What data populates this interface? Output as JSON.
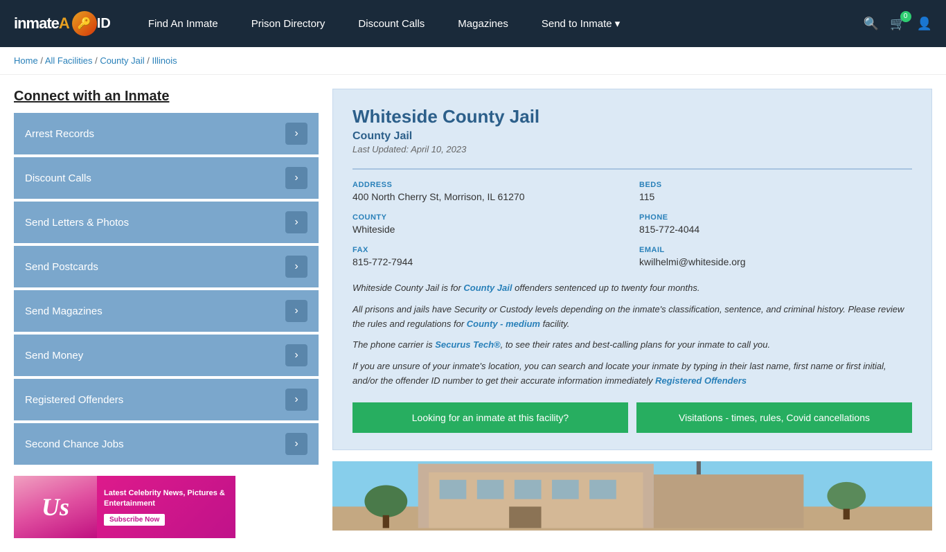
{
  "header": {
    "logo": "inmateAID",
    "nav": [
      {
        "label": "Find An Inmate",
        "id": "find-inmate"
      },
      {
        "label": "Prison Directory",
        "id": "prison-directory"
      },
      {
        "label": "Discount Calls",
        "id": "discount-calls"
      },
      {
        "label": "Magazines",
        "id": "magazines"
      },
      {
        "label": "Send to Inmate ▾",
        "id": "send-to-inmate"
      }
    ],
    "cart_count": "0"
  },
  "breadcrumb": {
    "items": [
      "Home",
      "All Facilities",
      "County Jail",
      "Illinois"
    ],
    "separator": " / "
  },
  "sidebar": {
    "title": "Connect with an Inmate",
    "menu": [
      {
        "label": "Arrest Records",
        "id": "arrest-records"
      },
      {
        "label": "Discount Calls",
        "id": "discount-calls"
      },
      {
        "label": "Send Letters & Photos",
        "id": "send-letters"
      },
      {
        "label": "Send Postcards",
        "id": "send-postcards"
      },
      {
        "label": "Send Magazines",
        "id": "send-magazines"
      },
      {
        "label": "Send Money",
        "id": "send-money"
      },
      {
        "label": "Registered Offenders",
        "id": "registered-offenders"
      },
      {
        "label": "Second Chance Jobs",
        "id": "second-chance-jobs"
      }
    ],
    "ad": {
      "brand": "Us",
      "headline": "Latest Celebrity News, Pictures & Entertainment",
      "button": "Subscribe Now"
    }
  },
  "facility": {
    "title": "Whiteside County Jail",
    "type": "County Jail",
    "last_updated": "Last Updated: April 10, 2023",
    "address_label": "ADDRESS",
    "address_value": "400 North Cherry St, Morrison, IL 61270",
    "beds_label": "BEDS",
    "beds_value": "115",
    "county_label": "COUNTY",
    "county_value": "Whiteside",
    "phone_label": "PHONE",
    "phone_value": "815-772-4044",
    "fax_label": "FAX",
    "fax_value": "815-772-7944",
    "email_label": "EMAIL",
    "email_value": "kwilhelmi@whiteside.org",
    "desc1": "Whiteside County Jail is for County Jail offenders sentenced up to twenty four months.",
    "desc1_link": "County Jail",
    "desc2": "All prisons and jails have Security or Custody levels depending on the inmate's classification, sentence, and criminal history. Please review the rules and regulations for County - medium facility.",
    "desc2_link": "County - medium",
    "desc3": "The phone carrier is Securus Tech®, to see their rates and best-calling plans for your inmate to call you.",
    "desc3_link": "Securus Tech®",
    "desc4": "If you are unsure of your inmate's location, you can search and locate your inmate by typing in their last name, first name or first initial, and/or the offender ID number to get their accurate information immediately Registered Offenders",
    "desc4_link": "Registered Offenders",
    "btn1": "Looking for an inmate at this facility?",
    "btn2": "Visitations - times, rules, Covid cancellations"
  }
}
